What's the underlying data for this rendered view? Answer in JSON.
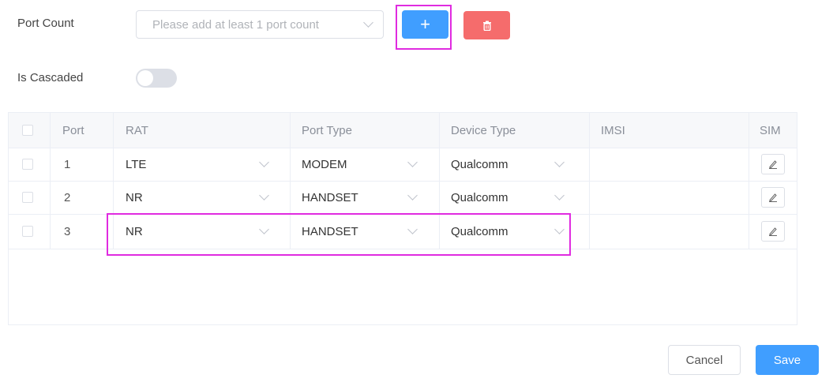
{
  "form": {
    "port_count_label": "Port Count",
    "port_count_placeholder": "Please add at least 1 port count",
    "add_label": "+",
    "is_cascaded_label": "Is Cascaded",
    "is_cascaded_on": false
  },
  "table": {
    "columns": {
      "port": "Port",
      "rat": "RAT",
      "port_type": "Port Type",
      "device_type": "Device Type",
      "imsi": "IMSI",
      "sim": "SIM"
    },
    "rows": [
      {
        "port": "1",
        "rat": "LTE",
        "port_type": "MODEM",
        "device_type": "Qualcomm",
        "imsi": ""
      },
      {
        "port": "2",
        "rat": "NR",
        "port_type": "HANDSET",
        "device_type": "Qualcomm",
        "imsi": ""
      },
      {
        "port": "3",
        "rat": "NR",
        "port_type": "HANDSET",
        "device_type": "Qualcomm",
        "imsi": ""
      }
    ]
  },
  "footer": {
    "cancel_label": "Cancel",
    "save_label": "Save"
  },
  "colors": {
    "primary": "#409eff",
    "danger": "#f56c6c",
    "highlight": "#e02be0"
  },
  "icons": {
    "delete": "trash-icon",
    "edit": "pencil-icon",
    "dropdown": "chevron-down-icon"
  }
}
